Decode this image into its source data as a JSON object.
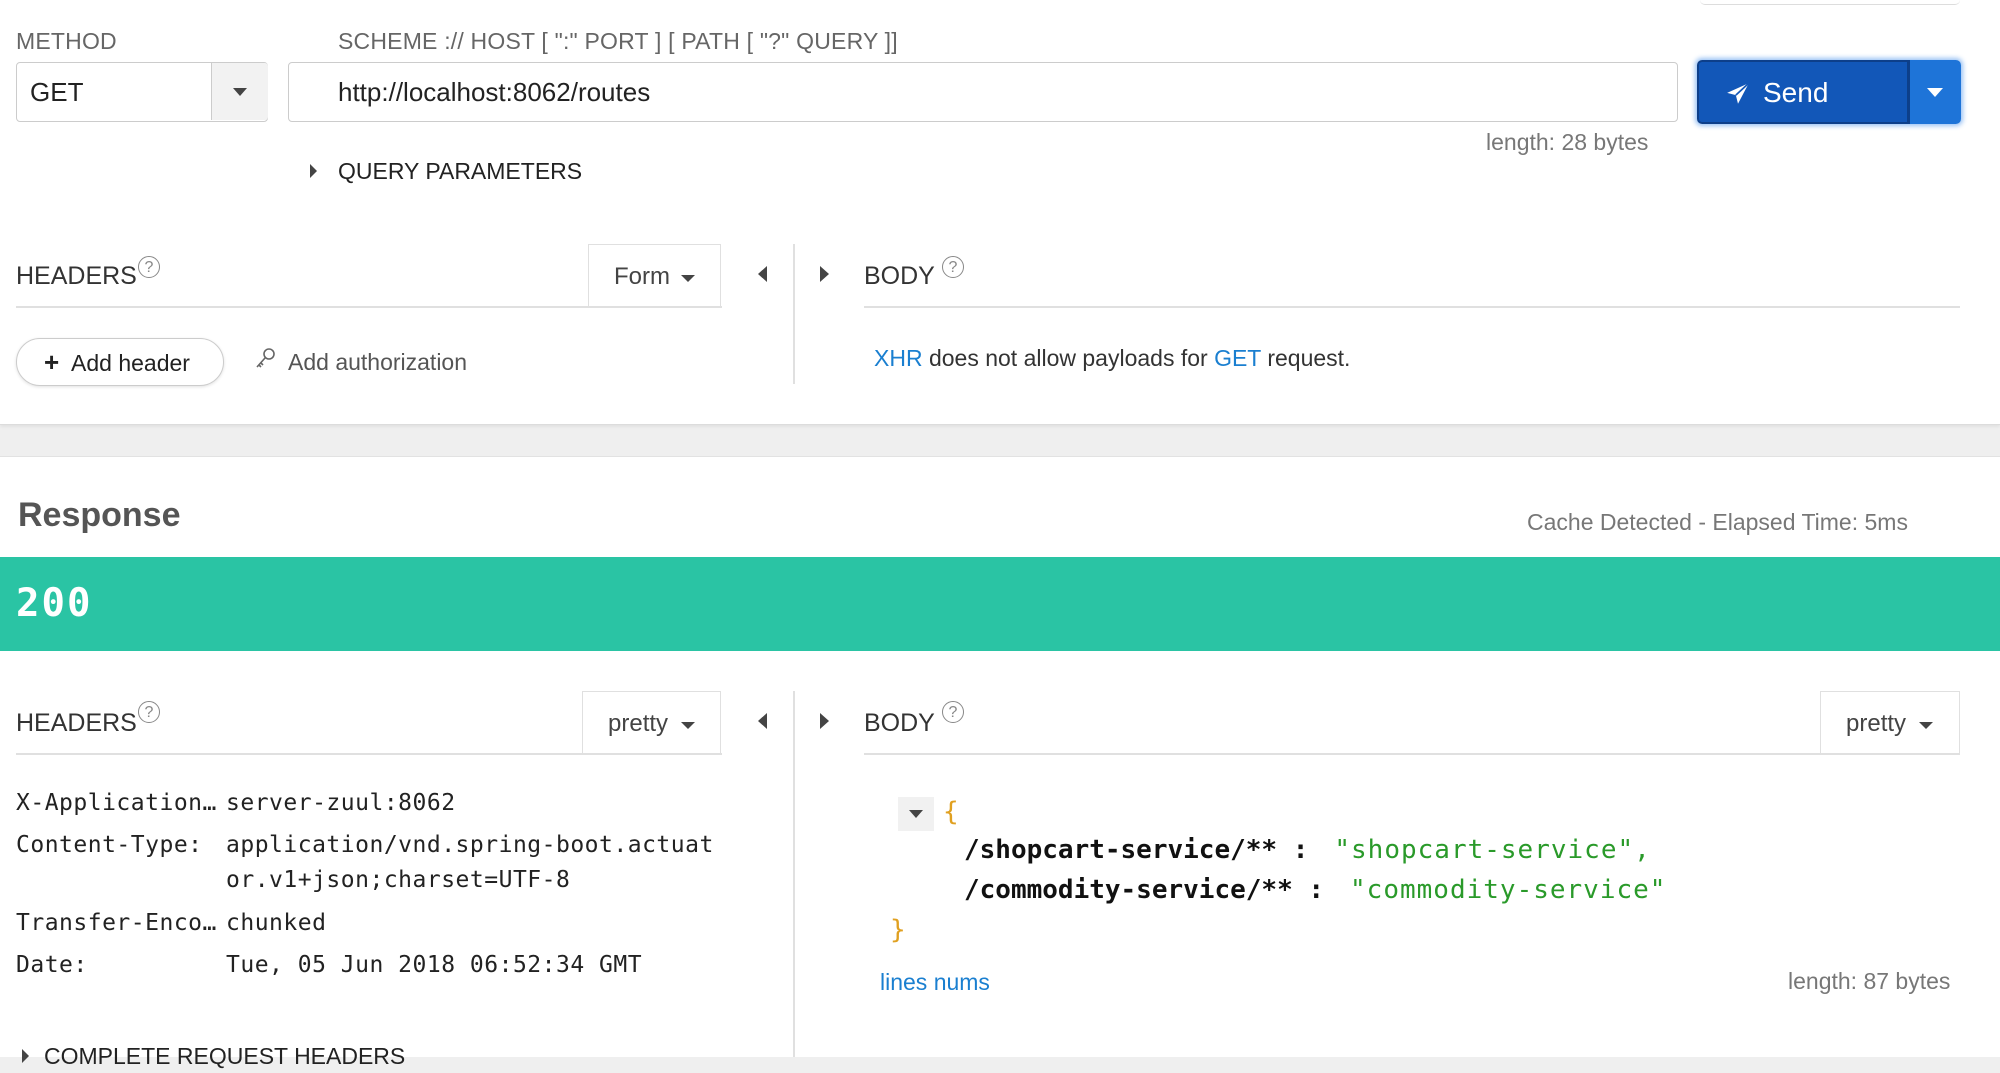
{
  "request": {
    "method_label": "METHOD",
    "method_value": "GET",
    "url_label": "SCHEME :// HOST [ \":\" PORT ] [ PATH [ \"?\" QUERY ]]",
    "url_value": "http://localhost:8062/routes",
    "url_length": "length: 28 bytes",
    "send_label": "Send",
    "query_params_label": "QUERY PARAMETERS",
    "headers_label": "HEADERS",
    "headers_mode": "Form",
    "add_header_label": "Add header",
    "add_auth_label": "Add authorization",
    "body_label": "BODY",
    "body_note": {
      "xhr": "XHR",
      "mid": " does not allow payloads for ",
      "method": "GET",
      "end": " request."
    }
  },
  "response": {
    "title": "Response",
    "cache_info": "Cache Detected - Elapsed Time: 5ms",
    "status_code": "200",
    "headers_label": "HEADERS",
    "headers_mode": "pretty",
    "headers": [
      {
        "key": "X-Application…",
        "value": "server-zuul:8062"
      },
      {
        "key": "Content-Type:",
        "value": "application/vnd.spring-boot.actuat",
        "value2": "or.v1+json;charset=UTF-8"
      },
      {
        "key": "Transfer-Enco…",
        "value": "chunked"
      },
      {
        "key": "Date:",
        "value": "Tue, 05 Jun 2018 06:52:34 GMT"
      }
    ],
    "complete_request_headers": "COMPLETE REQUEST HEADERS",
    "body_label": "BODY",
    "body_mode": "pretty",
    "json": {
      "open": "{",
      "close": "}",
      "entries": [
        {
          "key": "/shopcart-service/** :",
          "value": "\"shopcart-service\",",
          "sep": ""
        },
        {
          "key": "/commodity-service/** :",
          "value": "\"commodity-service\"",
          "sep": ""
        }
      ]
    },
    "lines_nums": "lines nums",
    "body_length": "length: 87 bytes"
  },
  "colors": {
    "send_bg": "#1565c0",
    "send_border": "#0d47a1",
    "status_bg": "#2ac4a4",
    "link": "#1a7fd0",
    "json_value": "#2a9a2a",
    "json_brace": "#e0a020"
  }
}
